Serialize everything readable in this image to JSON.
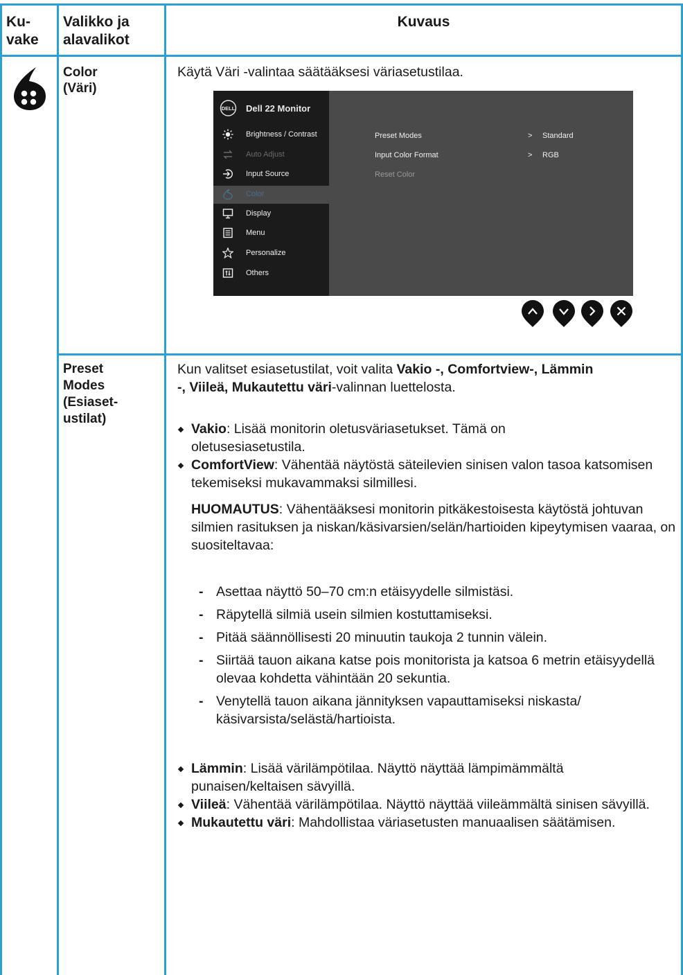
{
  "table": {
    "header": {
      "col1": [
        "Ku-",
        "vake"
      ],
      "col2": [
        "Valikko ja",
        "alavalikot"
      ],
      "col3": "Kuvaus"
    }
  },
  "row_color": {
    "menu_label": [
      "Color",
      "(Väri)"
    ],
    "description": "Käytä Väri -valintaa säätääksesi väriasetustilaa.",
    "osd": {
      "title": "Dell 22 Monitor",
      "logo_text": "DELL",
      "menu_items": [
        {
          "label": "Brightness / Contrast",
          "icon": "brightness-icon",
          "state": "normal"
        },
        {
          "label": "Auto Adjust",
          "icon": "auto-adjust-icon",
          "state": "disabled"
        },
        {
          "label": "Input Source",
          "icon": "input-source-icon",
          "state": "normal"
        },
        {
          "label": "Color",
          "icon": "color-drop-icon",
          "state": "selected"
        },
        {
          "label": "Display",
          "icon": "display-icon",
          "state": "normal"
        },
        {
          "label": "Menu",
          "icon": "menu-icon",
          "state": "normal"
        },
        {
          "label": "Personalize",
          "icon": "star-icon",
          "state": "normal"
        },
        {
          "label": "Others",
          "icon": "others-icon",
          "state": "normal"
        }
      ],
      "submenu": [
        {
          "label": "Preset Modes",
          "arrow": ">",
          "value": "Standard"
        },
        {
          "label": "Input Color Format",
          "arrow": ">",
          "value": "RGB"
        },
        {
          "label": "Reset Color",
          "arrow": "",
          "value": ""
        }
      ],
      "nav_buttons": [
        "up-icon",
        "down-icon",
        "right-icon",
        "close-icon"
      ]
    }
  },
  "row_preset": {
    "menu_label": [
      "Preset",
      "Modes",
      "(Esiaset-",
      "ustilat)"
    ],
    "intro": {
      "line1_plain": "Kun valitset esiasetustilat, voit valita ",
      "line1_bold": "Vakio -, Comfortview-, Lämmin",
      "line2_bold": "-, Viileä, Mukautettu väri",
      "line2_plain": "-valinnan luettelosta."
    },
    "bullets_a": [
      {
        "term": "Vakio",
        "text": ": Lisää monitorin oletusväriasetukset. Tämä on oletusesiasetustila."
      },
      {
        "term": "ComfortView",
        "text": ": Vähentää näytöstä säteilevien sinisen valon tasoa katsomisen tekemiseksi mukavammaksi silmillesi."
      }
    ],
    "note": {
      "term": "HUOMAUTUS",
      "text": ": Vähentääksesi monitorin pitkäkestoisesta käytöstä johtuvan silmien rasituksen ja niskan/käsivarsien/selän/hartioiden kipeytymisen vaaraa, on suositeltavaa:"
    },
    "dashes": [
      "Asettaa näyttö 50–70 cm:n etäisyydelle silmistäsi.",
      "Räpytellä silmiä usein silmien kostuttamiseksi.",
      "Pitää säännöllisesti 20 minuutin taukoja 2 tunnin välein.",
      "Siirtää tauon aikana katse pois monitorista ja katsoa 6 metrin etäisyydellä olevaa kohdetta vähintään 20 sekuntia.",
      "Venytellä tauon aikana jännityksen vapauttamiseksi niskasta/ käsivarsista/selästä/hartioista."
    ],
    "bullets_b": [
      {
        "term": "Lämmin",
        "text": ": Lisää värilämpötilaa. Näyttö näyttää lämpimämmältä punaisen/keltaisen sävyillä."
      },
      {
        "term": "Viileä",
        "text": ": Vähentää värilämpötilaa. Näyttö näyttää viileämmältä sinisen sävyillä."
      },
      {
        "term": "Mukautettu väri",
        "text": ": Mahdollistaa väriasetusten manuaalisen säätämisen."
      }
    ]
  },
  "colors": {
    "grid": "#2a9fd8",
    "osd_left": "#1b1b1b",
    "osd_right": "#4a4a4a",
    "osd_selected_text": "#4a6f8a"
  }
}
